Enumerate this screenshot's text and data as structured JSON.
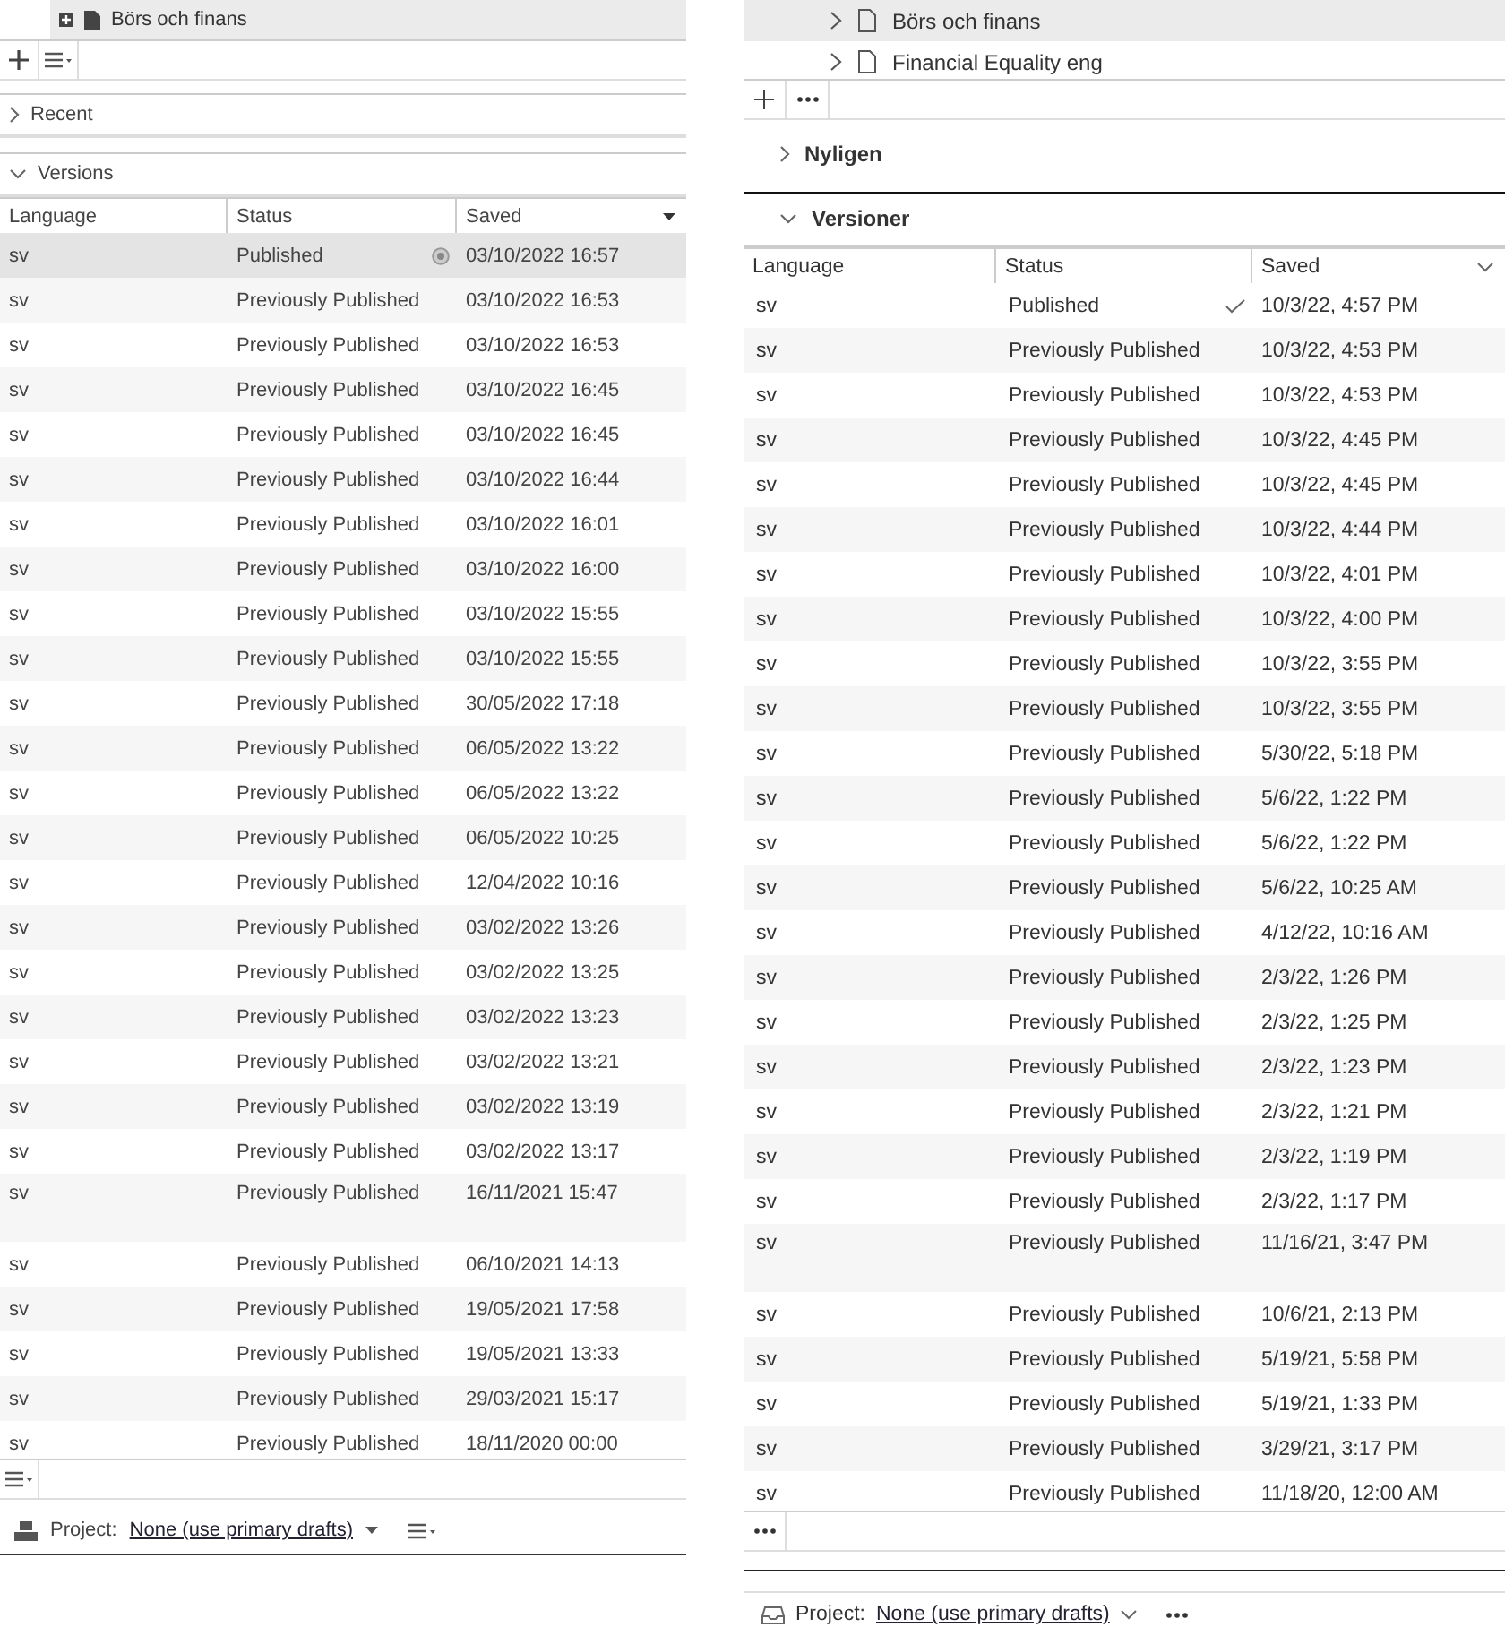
{
  "panels": [
    {
      "kind": "classic",
      "tree_items": [
        {
          "label": "Börs och finans",
          "selected": true
        }
      ],
      "sections": [
        {
          "label": "Recent",
          "expanded": false
        },
        {
          "label": "Versions",
          "expanded": true
        }
      ],
      "table": {
        "columns": [
          "Language",
          "Status",
          "Saved"
        ],
        "rows": [
          {
            "language": "sv",
            "status": "Published",
            "saved": "03/10/2022 16:57",
            "current": true,
            "selected": true
          },
          {
            "language": "sv",
            "status": "Previously Published",
            "saved": "03/10/2022 16:53",
            "current": false,
            "selected": false
          },
          {
            "language": "sv",
            "status": "Previously Published",
            "saved": "03/10/2022 16:53",
            "current": false,
            "selected": false
          },
          {
            "language": "sv",
            "status": "Previously Published",
            "saved": "03/10/2022 16:45",
            "current": false,
            "selected": false
          },
          {
            "language": "sv",
            "status": "Previously Published",
            "saved": "03/10/2022 16:45",
            "current": false,
            "selected": false
          },
          {
            "language": "sv",
            "status": "Previously Published",
            "saved": "03/10/2022 16:44",
            "current": false,
            "selected": false
          },
          {
            "language": "sv",
            "status": "Previously Published",
            "saved": "03/10/2022 16:01",
            "current": false,
            "selected": false
          },
          {
            "language": "sv",
            "status": "Previously Published",
            "saved": "03/10/2022 16:00",
            "current": false,
            "selected": false
          },
          {
            "language": "sv",
            "status": "Previously Published",
            "saved": "03/10/2022 15:55",
            "current": false,
            "selected": false
          },
          {
            "language": "sv",
            "status": "Previously Published",
            "saved": "03/10/2022 15:55",
            "current": false,
            "selected": false
          },
          {
            "language": "sv",
            "status": "Previously Published",
            "saved": "30/05/2022 17:18",
            "current": false,
            "selected": false
          },
          {
            "language": "sv",
            "status": "Previously Published",
            "saved": "06/05/2022 13:22",
            "current": false,
            "selected": false
          },
          {
            "language": "sv",
            "status": "Previously Published",
            "saved": "06/05/2022 13:22",
            "current": false,
            "selected": false
          },
          {
            "language": "sv",
            "status": "Previously Published",
            "saved": "06/05/2022 10:25",
            "current": false,
            "selected": false
          },
          {
            "language": "sv",
            "status": "Previously Published",
            "saved": "12/04/2022 10:16",
            "current": false,
            "selected": false
          },
          {
            "language": "sv",
            "status": "Previously Published",
            "saved": "03/02/2022 13:26",
            "current": false,
            "selected": false
          },
          {
            "language": "sv",
            "status": "Previously Published",
            "saved": "03/02/2022 13:25",
            "current": false,
            "selected": false
          },
          {
            "language": "sv",
            "status": "Previously Published",
            "saved": "03/02/2022 13:23",
            "current": false,
            "selected": false
          },
          {
            "language": "sv",
            "status": "Previously Published",
            "saved": "03/02/2022 13:21",
            "current": false,
            "selected": false
          },
          {
            "language": "sv",
            "status": "Previously Published",
            "saved": "03/02/2022 13:19",
            "current": false,
            "selected": false
          },
          {
            "language": "sv",
            "status": "Previously Published",
            "saved": "03/02/2022 13:17",
            "current": false,
            "selected": false
          },
          {
            "language": "sv",
            "status": "Previously Published",
            "saved": "16/11/2021 15:47",
            "current": false,
            "selected": false,
            "tall": true
          },
          {
            "language": "sv",
            "status": "Previously Published",
            "saved": "06/10/2021 14:13",
            "current": false,
            "selected": false
          },
          {
            "language": "sv",
            "status": "Previously Published",
            "saved": "19/05/2021 17:58",
            "current": false,
            "selected": false
          },
          {
            "language": "sv",
            "status": "Previously Published",
            "saved": "19/05/2021 13:33",
            "current": false,
            "selected": false
          },
          {
            "language": "sv",
            "status": "Previously Published",
            "saved": "29/03/2021 15:17",
            "current": false,
            "selected": false
          },
          {
            "language": "sv",
            "status": "Previously Published",
            "saved": "18/11/2020 00:00",
            "current": false,
            "selected": false
          }
        ]
      },
      "project": {
        "label": "Project:",
        "value": "None (use primary drafts)"
      }
    },
    {
      "kind": "modern",
      "tree_items": [
        {
          "label": "Börs och finans",
          "selected": true
        },
        {
          "label": "Financial Equality eng",
          "selected": false
        }
      ],
      "sections": [
        {
          "label": "Nyligen",
          "expanded": false
        },
        {
          "label": "Versioner",
          "expanded": true
        }
      ],
      "table": {
        "columns": [
          "Language",
          "Status",
          "Saved"
        ],
        "rows": [
          {
            "language": "sv",
            "status": "Published",
            "saved": "10/3/22, 4:57 PM",
            "current": true,
            "selected": false
          },
          {
            "language": "sv",
            "status": "Previously Published",
            "saved": "10/3/22, 4:53 PM",
            "current": false,
            "selected": false
          },
          {
            "language": "sv",
            "status": "Previously Published",
            "saved": "10/3/22, 4:53 PM",
            "current": false,
            "selected": false
          },
          {
            "language": "sv",
            "status": "Previously Published",
            "saved": "10/3/22, 4:45 PM",
            "current": false,
            "selected": false
          },
          {
            "language": "sv",
            "status": "Previously Published",
            "saved": "10/3/22, 4:45 PM",
            "current": false,
            "selected": false
          },
          {
            "language": "sv",
            "status": "Previously Published",
            "saved": "10/3/22, 4:44 PM",
            "current": false,
            "selected": false
          },
          {
            "language": "sv",
            "status": "Previously Published",
            "saved": "10/3/22, 4:01 PM",
            "current": false,
            "selected": false
          },
          {
            "language": "sv",
            "status": "Previously Published",
            "saved": "10/3/22, 4:00 PM",
            "current": false,
            "selected": false
          },
          {
            "language": "sv",
            "status": "Previously Published",
            "saved": "10/3/22, 3:55 PM",
            "current": false,
            "selected": false
          },
          {
            "language": "sv",
            "status": "Previously Published",
            "saved": "10/3/22, 3:55 PM",
            "current": false,
            "selected": false
          },
          {
            "language": "sv",
            "status": "Previously Published",
            "saved": "5/30/22, 5:18 PM",
            "current": false,
            "selected": false
          },
          {
            "language": "sv",
            "status": "Previously Published",
            "saved": "5/6/22, 1:22 PM",
            "current": false,
            "selected": false
          },
          {
            "language": "sv",
            "status": "Previously Published",
            "saved": "5/6/22, 1:22 PM",
            "current": false,
            "selected": false
          },
          {
            "language": "sv",
            "status": "Previously Published",
            "saved": "5/6/22, 10:25 AM",
            "current": false,
            "selected": false
          },
          {
            "language": "sv",
            "status": "Previously Published",
            "saved": "4/12/22, 10:16 AM",
            "current": false,
            "selected": false
          },
          {
            "language": "sv",
            "status": "Previously Published",
            "saved": "2/3/22, 1:26 PM",
            "current": false,
            "selected": false
          },
          {
            "language": "sv",
            "status": "Previously Published",
            "saved": "2/3/22, 1:25 PM",
            "current": false,
            "selected": false
          },
          {
            "language": "sv",
            "status": "Previously Published",
            "saved": "2/3/22, 1:23 PM",
            "current": false,
            "selected": false
          },
          {
            "language": "sv",
            "status": "Previously Published",
            "saved": "2/3/22, 1:21 PM",
            "current": false,
            "selected": false
          },
          {
            "language": "sv",
            "status": "Previously Published",
            "saved": "2/3/22, 1:19 PM",
            "current": false,
            "selected": false
          },
          {
            "language": "sv",
            "status": "Previously Published",
            "saved": "2/3/22, 1:17 PM",
            "current": false,
            "selected": false
          },
          {
            "language": "sv",
            "status": "Previously Published",
            "saved": "11/16/21, 3:47 PM",
            "current": false,
            "selected": false,
            "tall": true
          },
          {
            "language": "sv",
            "status": "Previously Published",
            "saved": "10/6/21, 2:13 PM",
            "current": false,
            "selected": false
          },
          {
            "language": "sv",
            "status": "Previously Published",
            "saved": "5/19/21, 5:58 PM",
            "current": false,
            "selected": false
          },
          {
            "language": "sv",
            "status": "Previously Published",
            "saved": "5/19/21, 1:33 PM",
            "current": false,
            "selected": false
          },
          {
            "language": "sv",
            "status": "Previously Published",
            "saved": "3/29/21, 3:17 PM",
            "current": false,
            "selected": false
          },
          {
            "language": "sv",
            "status": "Previously Published",
            "saved": "11/18/20, 12:00 AM",
            "current": false,
            "selected": false
          }
        ]
      },
      "project": {
        "label": "Project:",
        "value": "None (use primary drafts)"
      }
    }
  ]
}
